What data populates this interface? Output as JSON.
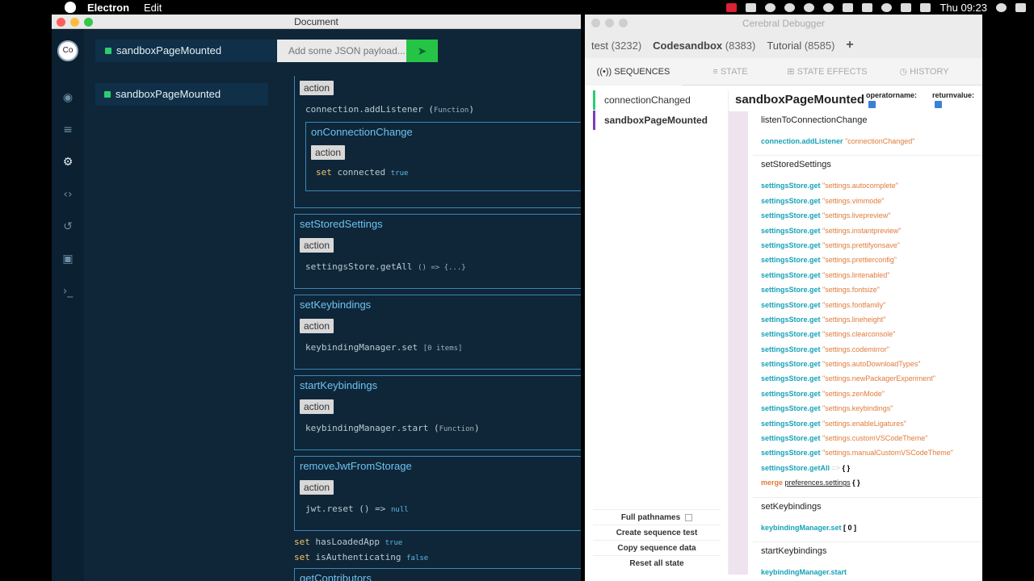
{
  "menubar": {
    "app_name": "Electron",
    "menus": [
      "Edit"
    ],
    "clock": "Thu 09:23"
  },
  "doc_window": {
    "title": "Document",
    "avatar": "Co",
    "sequence_pill": "sandboxPageMounted",
    "payload_placeholder": "Add some JSON payload...",
    "sequence_list_item": "sandboxPageMounted",
    "trace": {
      "action_tag": "action",
      "add_listener": {
        "expr": "connection.addListener",
        "arg": "Function"
      },
      "on_connection_change": {
        "title": "onConnectionChange",
        "set_kw": "set",
        "path": "connected",
        "value": "true"
      },
      "blocks": [
        {
          "title": "setStoredSettings",
          "expr": "settingsStore.getAll",
          "arg": "() => {...}"
        },
        {
          "title": "setKeybindings",
          "expr": "keybindingManager.set",
          "arg": "[0 items]"
        },
        {
          "title": "startKeybindings",
          "expr": "keybindingManager.start",
          "arg": "Function"
        },
        {
          "title": "removeJwtFromStorage",
          "expr": "jwt.reset",
          "arg": "() =>",
          "ret": "null"
        }
      ],
      "sets": [
        {
          "kw": "set",
          "path": "hasLoadedApp",
          "value": "true"
        },
        {
          "kw": "set",
          "path": "isAuthenticating",
          "value": "false"
        }
      ],
      "next_block": "getContributors"
    }
  },
  "debugger": {
    "title": "Cerebral Debugger",
    "apps": [
      {
        "name": "test",
        "count": "(3232)"
      },
      {
        "name": "Codesandbox",
        "count": "(8383)"
      },
      {
        "name": "Tutorial",
        "count": "(8585)"
      }
    ],
    "add_label": "+",
    "nav": [
      "SEQUENCES",
      "STATE",
      "STATE EFFECTS",
      "HISTORY"
    ],
    "sequences": [
      "connectionChanged",
      "sandboxPageMounted"
    ],
    "buttons": [
      "Full pathnames",
      "Create sequence test",
      "Copy sequence data",
      "Reset all state"
    ],
    "detail": {
      "title": "sandboxPageMounted",
      "opt_operator": "operatorname:",
      "opt_return": "returnvalue:",
      "sections": [
        {
          "heading": "listenToConnectionChange",
          "lines": [
            {
              "op": "connection.addListener",
              "arg": "\"connectionChanged\""
            }
          ]
        },
        {
          "heading": "setStoredSettings",
          "lines": [
            {
              "op": "settingsStore.get",
              "arg": "\"settings.autocomplete\""
            },
            {
              "op": "settingsStore.get",
              "arg": "\"settings.vimmode\""
            },
            {
              "op": "settingsStore.get",
              "arg": "\"settings.livepreview\""
            },
            {
              "op": "settingsStore.get",
              "arg": "\"settings.instantpreview\""
            },
            {
              "op": "settingsStore.get",
              "arg": "\"settings.prettifyonsave\""
            },
            {
              "op": "settingsStore.get",
              "arg": "\"settings.prettierconfig\""
            },
            {
              "op": "settingsStore.get",
              "arg": "\"settings.lintenabled\""
            },
            {
              "op": "settingsStore.get",
              "arg": "\"settings.fontsize\""
            },
            {
              "op": "settingsStore.get",
              "arg": "\"settings.fontfamily\""
            },
            {
              "op": "settingsStore.get",
              "arg": "\"settings.lineheight\""
            },
            {
              "op": "settingsStore.get",
              "arg": "\"settings.clearconsole\""
            },
            {
              "op": "settingsStore.get",
              "arg": "\"settings.codemirror\""
            },
            {
              "op": "settingsStore.get",
              "arg": "\"settings.autoDownloadTypes\""
            },
            {
              "op": "settingsStore.get",
              "arg": "\"settings.newPackagerExperiment\""
            },
            {
              "op": "settingsStore.get",
              "arg": "\"settings.zenMode\""
            },
            {
              "op": "settingsStore.get",
              "arg": "\"settings.keybindings\""
            },
            {
              "op": "settingsStore.get",
              "arg": "\"settings.enableLigatures\""
            },
            {
              "op": "settingsStore.get",
              "arg": "\"settings.customVSCodeTheme\""
            },
            {
              "op": "settingsStore.get",
              "arg": "\"settings.manualCustomVSCodeTheme\""
            }
          ]
        },
        {
          "heading": "setKeybindings",
          "lines": [
            {
              "op": "keybindingManager.set",
              "arg": "[ 0 ]"
            }
          ]
        },
        {
          "heading": "startKeybindings",
          "lines": [
            {
              "op": "keybindingManager.start",
              "arg": ""
            }
          ]
        }
      ],
      "get_all": {
        "op": "settingsStore.getAll",
        "arrow": "=>",
        "obj": "{ }"
      },
      "merge": {
        "op": "merge",
        "path": "preferences.settings",
        "obj": "{ }"
      }
    }
  }
}
